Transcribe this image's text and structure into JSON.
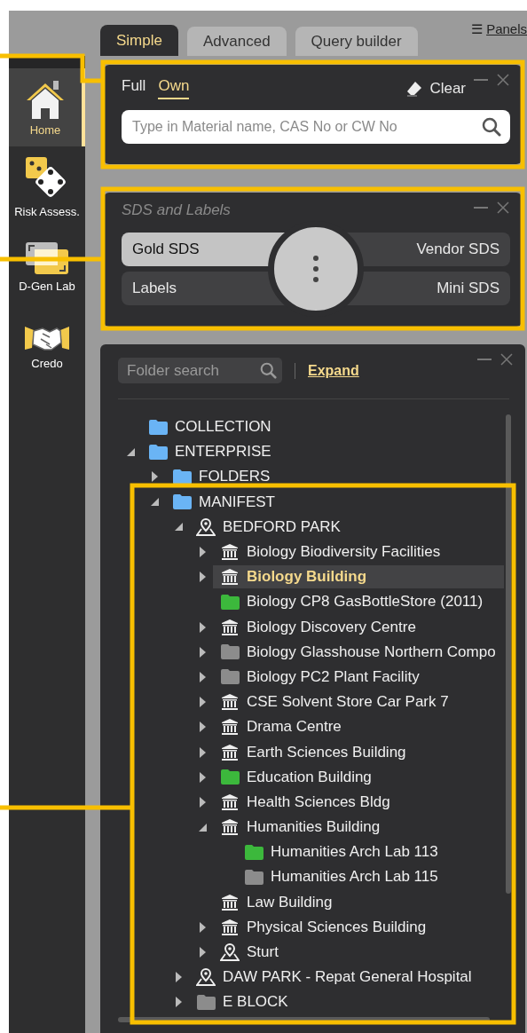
{
  "sidebar": {
    "items": [
      {
        "kind": "home",
        "label": "Home",
        "selected": true
      },
      {
        "kind": "dice",
        "label": "Risk Assess.",
        "selected": false
      },
      {
        "kind": "windows",
        "label": "D-Gen Lab",
        "selected": false
      },
      {
        "kind": "handshake",
        "label": "Credo",
        "selected": false
      }
    ]
  },
  "tabs": [
    {
      "label": "Simple",
      "selected": true
    },
    {
      "label": "Advanced",
      "selected": false
    },
    {
      "label": "Query builder",
      "selected": false
    }
  ],
  "panels_link": {
    "icon": "☰",
    "label": "Panels"
  },
  "search_panel": {
    "modes": [
      {
        "label": "Full",
        "selected": false
      },
      {
        "label": "Own",
        "selected": true
      }
    ],
    "clear": "Clear",
    "placeholder": "Type in Material name, CAS No or CW No"
  },
  "sds_panel": {
    "title": "SDS and Labels",
    "options": [
      {
        "label": "Gold SDS",
        "selected": true
      },
      {
        "label": "Vendor SDS",
        "selected": false
      },
      {
        "label": "Labels",
        "selected": false
      },
      {
        "label": "Mini SDS",
        "selected": false
      }
    ]
  },
  "folder_panel": {
    "search_placeholder": "Folder search",
    "expand": "Expand",
    "tree": [
      {
        "kind": "folder",
        "color": "#6ab4f5",
        "label": "COLLECTION",
        "expandable": false,
        "selected": false
      },
      {
        "kind": "folder",
        "color": "#6ab4f5",
        "label": "ENTERPRISE",
        "expandable": true,
        "expanded": true,
        "selected": false,
        "children": [
          {
            "kind": "folder",
            "color": "#6ab4f5",
            "label": "FOLDERS",
            "expandable": true,
            "expanded": false,
            "selected": false
          },
          {
            "kind": "folder",
            "color": "#6ab4f5",
            "label": "MANIFEST",
            "expandable": true,
            "expanded": true,
            "selected": false,
            "children": [
              {
                "kind": "site",
                "label": "BEDFORD PARK",
                "expandable": true,
                "expanded": true,
                "selected": false,
                "children": [
                  {
                    "kind": "building",
                    "label": "Biology Biodiversity Facilities",
                    "expandable": true,
                    "expanded": false,
                    "selected": false
                  },
                  {
                    "kind": "building",
                    "label": "Biology Building",
                    "expandable": true,
                    "expanded": false,
                    "selected": true
                  },
                  {
                    "kind": "folder",
                    "color": "#3cb83c",
                    "label": "Biology CP8 GasBottleStore (2011)",
                    "expandable": false,
                    "selected": false
                  },
                  {
                    "kind": "building",
                    "label": "Biology Discovery Centre",
                    "expandable": true,
                    "expanded": false,
                    "selected": false
                  },
                  {
                    "kind": "folder",
                    "color": "#8c8c8c",
                    "label": "Biology Glasshouse Northern Compo",
                    "expandable": true,
                    "expanded": false,
                    "selected": false
                  },
                  {
                    "kind": "folder",
                    "color": "#8c8c8c",
                    "label": "Biology PC2 Plant Facility",
                    "expandable": true,
                    "expanded": false,
                    "selected": false
                  },
                  {
                    "kind": "building",
                    "label": "CSE Solvent Store Car Park 7",
                    "expandable": true,
                    "expanded": false,
                    "selected": false
                  },
                  {
                    "kind": "building",
                    "label": "Drama Centre",
                    "expandable": true,
                    "expanded": false,
                    "selected": false
                  },
                  {
                    "kind": "building",
                    "label": "Earth Sciences Building",
                    "expandable": true,
                    "expanded": false,
                    "selected": false
                  },
                  {
                    "kind": "folder",
                    "color": "#3cb83c",
                    "label": "Education Building",
                    "expandable": true,
                    "expanded": false,
                    "selected": false
                  },
                  {
                    "kind": "building",
                    "label": "Health Sciences Bldg",
                    "expandable": true,
                    "expanded": false,
                    "selected": false
                  },
                  {
                    "kind": "building",
                    "label": "Humanities Building",
                    "expandable": true,
                    "expanded": true,
                    "selected": false,
                    "children": [
                      {
                        "kind": "folder",
                        "color": "#3cb83c",
                        "label": "Humanities Arch Lab 113",
                        "expandable": false,
                        "selected": false
                      },
                      {
                        "kind": "folder",
                        "color": "#8c8c8c",
                        "label": "Humanities Arch Lab 115",
                        "expandable": false,
                        "selected": false
                      }
                    ]
                  },
                  {
                    "kind": "building",
                    "label": "Law Building",
                    "expandable": false,
                    "selected": false
                  },
                  {
                    "kind": "building",
                    "label": "Physical Sciences Building",
                    "expandable": true,
                    "expanded": false,
                    "selected": false
                  },
                  {
                    "kind": "site",
                    "label": "Sturt",
                    "expandable": true,
                    "expanded": false,
                    "selected": false
                  }
                ]
              },
              {
                "kind": "site",
                "label": "DAW PARK - Repat General Hospital",
                "expandable": true,
                "expanded": false,
                "selected": false
              },
              {
                "kind": "folder",
                "color": "#8c8c8c",
                "label": "E BLOCK",
                "expandable": true,
                "expanded": false,
                "selected": false
              }
            ]
          }
        ]
      }
    ]
  }
}
